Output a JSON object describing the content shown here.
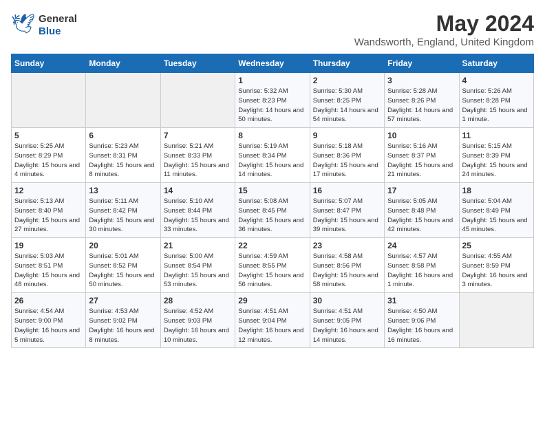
{
  "header": {
    "logo_general": "General",
    "logo_blue": "Blue",
    "month": "May 2024",
    "location": "Wandsworth, England, United Kingdom"
  },
  "days_of_week": [
    "Sunday",
    "Monday",
    "Tuesday",
    "Wednesday",
    "Thursday",
    "Friday",
    "Saturday"
  ],
  "weeks": [
    [
      null,
      null,
      null,
      {
        "day": 1,
        "sunrise": "5:32 AM",
        "sunset": "8:23 PM",
        "daylight": "14 hours and 50 minutes."
      },
      {
        "day": 2,
        "sunrise": "5:30 AM",
        "sunset": "8:25 PM",
        "daylight": "14 hours and 54 minutes."
      },
      {
        "day": 3,
        "sunrise": "5:28 AM",
        "sunset": "8:26 PM",
        "daylight": "14 hours and 57 minutes."
      },
      {
        "day": 4,
        "sunrise": "5:26 AM",
        "sunset": "8:28 PM",
        "daylight": "15 hours and 1 minute."
      }
    ],
    [
      {
        "day": 5,
        "sunrise": "5:25 AM",
        "sunset": "8:29 PM",
        "daylight": "15 hours and 4 minutes."
      },
      {
        "day": 6,
        "sunrise": "5:23 AM",
        "sunset": "8:31 PM",
        "daylight": "15 hours and 8 minutes."
      },
      {
        "day": 7,
        "sunrise": "5:21 AM",
        "sunset": "8:33 PM",
        "daylight": "15 hours and 11 minutes."
      },
      {
        "day": 8,
        "sunrise": "5:19 AM",
        "sunset": "8:34 PM",
        "daylight": "15 hours and 14 minutes."
      },
      {
        "day": 9,
        "sunrise": "5:18 AM",
        "sunset": "8:36 PM",
        "daylight": "15 hours and 17 minutes."
      },
      {
        "day": 10,
        "sunrise": "5:16 AM",
        "sunset": "8:37 PM",
        "daylight": "15 hours and 21 minutes."
      },
      {
        "day": 11,
        "sunrise": "5:15 AM",
        "sunset": "8:39 PM",
        "daylight": "15 hours and 24 minutes."
      }
    ],
    [
      {
        "day": 12,
        "sunrise": "5:13 AM",
        "sunset": "8:40 PM",
        "daylight": "15 hours and 27 minutes."
      },
      {
        "day": 13,
        "sunrise": "5:11 AM",
        "sunset": "8:42 PM",
        "daylight": "15 hours and 30 minutes."
      },
      {
        "day": 14,
        "sunrise": "5:10 AM",
        "sunset": "8:44 PM",
        "daylight": "15 hours and 33 minutes."
      },
      {
        "day": 15,
        "sunrise": "5:08 AM",
        "sunset": "8:45 PM",
        "daylight": "15 hours and 36 minutes."
      },
      {
        "day": 16,
        "sunrise": "5:07 AM",
        "sunset": "8:47 PM",
        "daylight": "15 hours and 39 minutes."
      },
      {
        "day": 17,
        "sunrise": "5:05 AM",
        "sunset": "8:48 PM",
        "daylight": "15 hours and 42 minutes."
      },
      {
        "day": 18,
        "sunrise": "5:04 AM",
        "sunset": "8:49 PM",
        "daylight": "15 hours and 45 minutes."
      }
    ],
    [
      {
        "day": 19,
        "sunrise": "5:03 AM",
        "sunset": "8:51 PM",
        "daylight": "15 hours and 48 minutes."
      },
      {
        "day": 20,
        "sunrise": "5:01 AM",
        "sunset": "8:52 PM",
        "daylight": "15 hours and 50 minutes."
      },
      {
        "day": 21,
        "sunrise": "5:00 AM",
        "sunset": "8:54 PM",
        "daylight": "15 hours and 53 minutes."
      },
      {
        "day": 22,
        "sunrise": "4:59 AM",
        "sunset": "8:55 PM",
        "daylight": "15 hours and 56 minutes."
      },
      {
        "day": 23,
        "sunrise": "4:58 AM",
        "sunset": "8:56 PM",
        "daylight": "15 hours and 58 minutes."
      },
      {
        "day": 24,
        "sunrise": "4:57 AM",
        "sunset": "8:58 PM",
        "daylight": "16 hours and 1 minute."
      },
      {
        "day": 25,
        "sunrise": "4:55 AM",
        "sunset": "8:59 PM",
        "daylight": "16 hours and 3 minutes."
      }
    ],
    [
      {
        "day": 26,
        "sunrise": "4:54 AM",
        "sunset": "9:00 PM",
        "daylight": "16 hours and 5 minutes."
      },
      {
        "day": 27,
        "sunrise": "4:53 AM",
        "sunset": "9:02 PM",
        "daylight": "16 hours and 8 minutes."
      },
      {
        "day": 28,
        "sunrise": "4:52 AM",
        "sunset": "9:03 PM",
        "daylight": "16 hours and 10 minutes."
      },
      {
        "day": 29,
        "sunrise": "4:51 AM",
        "sunset": "9:04 PM",
        "daylight": "16 hours and 12 minutes."
      },
      {
        "day": 30,
        "sunrise": "4:51 AM",
        "sunset": "9:05 PM",
        "daylight": "16 hours and 14 minutes."
      },
      {
        "day": 31,
        "sunrise": "4:50 AM",
        "sunset": "9:06 PM",
        "daylight": "16 hours and 16 minutes."
      },
      null
    ]
  ]
}
